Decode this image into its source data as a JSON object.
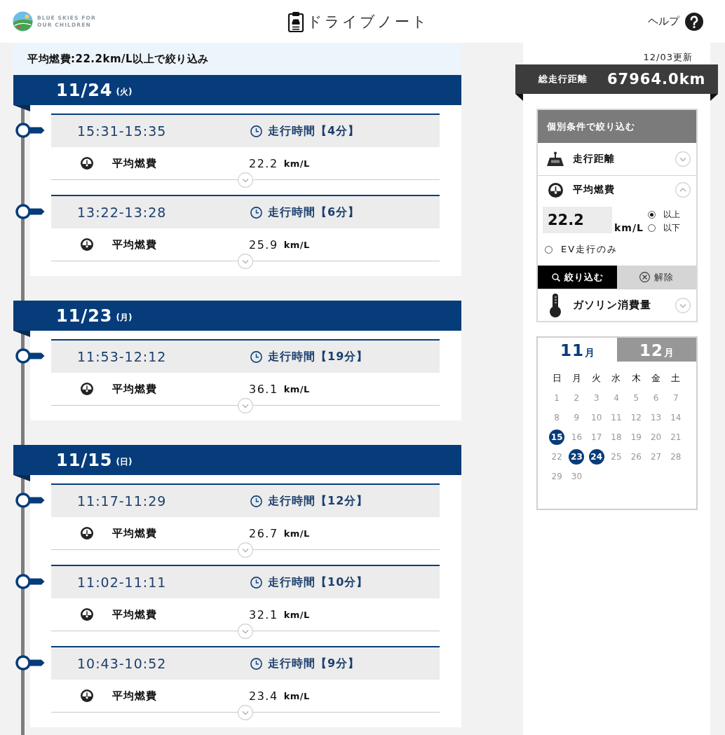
{
  "header": {
    "logo_lines": [
      "BLUE SKIES FOR",
      "OUR CHILDREN"
    ],
    "title": "ドライブノート",
    "help": "ヘルプ"
  },
  "filter_banner": "平均燃費:22.2km/L以上で絞り込み",
  "days": [
    {
      "date": "11/24",
      "weekday": "(火)",
      "trips": [
        {
          "time": "15:31-15:35",
          "duration": "走行時間【4分】",
          "metric_label": "平均燃費",
          "metric_value": "22.2",
          "metric_unit": "km/L",
          "expanded": false
        },
        {
          "time": "13:22-13:28",
          "duration": "走行時間【6分】",
          "metric_label": "平均燃費",
          "metric_value": "25.9",
          "metric_unit": "km/L",
          "expanded": false
        }
      ]
    },
    {
      "date": "11/23",
      "weekday": "(月)",
      "trips": [
        {
          "time": "11:53-12:12",
          "duration": "走行時間【19分】",
          "metric_label": "平均燃費",
          "metric_value": "36.1",
          "metric_unit": "km/L",
          "expanded": false
        }
      ]
    },
    {
      "date": "11/15",
      "weekday": "(日)",
      "trips": [
        {
          "time": "11:17-11:29",
          "duration": "走行時間【12分】",
          "metric_label": "平均燃費",
          "metric_value": "26.7",
          "metric_unit": "km/L",
          "expanded": false
        },
        {
          "time": "11:02-11:11",
          "duration": "走行時間【10分】",
          "metric_label": "平均燃費",
          "metric_value": "32.1",
          "metric_unit": "km/L",
          "expanded": false
        },
        {
          "time": "10:43-10:52",
          "duration": "走行時間【9分】",
          "metric_label": "平均燃費",
          "metric_value": "23.4",
          "metric_unit": "km/L",
          "expanded": false
        }
      ]
    }
  ],
  "sidebar": {
    "updated": "12/03更新",
    "total_distance": {
      "label": "総走行距離",
      "value": "67964.0km"
    },
    "filter": {
      "title": "個別条件で絞り込む",
      "sections": [
        {
          "label": "走行距離",
          "expanded": false
        },
        {
          "label": "平均燃費",
          "expanded": true,
          "value": "22.2",
          "unit": "km/L",
          "options": [
            {
              "label": "以上",
              "selected": true
            },
            {
              "label": "以下",
              "selected": false
            }
          ],
          "ev_only": {
            "label": "EV走行のみ",
            "checked": false
          },
          "buttons": [
            {
              "kind": "apply",
              "label": "絞り込む"
            },
            {
              "kind": "clear",
              "label": "解除"
            }
          ]
        },
        {
          "label": "ガソリン消費量",
          "expanded": false
        }
      ]
    },
    "calendar": {
      "tabs": [
        {
          "month": "11",
          "suffix": "月",
          "selected": true
        },
        {
          "month": "12",
          "suffix": "月",
          "selected": false
        }
      ],
      "weekdays": [
        "日",
        "月",
        "火",
        "水",
        "木",
        "金",
        "土"
      ],
      "dates": [
        {
          "day": "1",
          "highlighted": false
        },
        {
          "day": "2",
          "highlighted": false
        },
        {
          "day": "3",
          "highlighted": false
        },
        {
          "day": "4",
          "highlighted": false
        },
        {
          "day": "5",
          "highlighted": false
        },
        {
          "day": "6",
          "highlighted": false
        },
        {
          "day": "7",
          "highlighted": false
        },
        {
          "day": "8",
          "highlighted": false
        },
        {
          "day": "9",
          "highlighted": false
        },
        {
          "day": "10",
          "highlighted": false
        },
        {
          "day": "11",
          "highlighted": false
        },
        {
          "day": "12",
          "highlighted": false
        },
        {
          "day": "13",
          "highlighted": false
        },
        {
          "day": "14",
          "highlighted": false
        },
        {
          "day": "15",
          "highlighted": true
        },
        {
          "day": "16",
          "highlighted": false
        },
        {
          "day": "17",
          "highlighted": false
        },
        {
          "day": "18",
          "highlighted": false
        },
        {
          "day": "19",
          "highlighted": false
        },
        {
          "day": "20",
          "highlighted": false
        },
        {
          "day": "21",
          "highlighted": false
        },
        {
          "day": "22",
          "highlighted": false
        },
        {
          "day": "23",
          "highlighted": true
        },
        {
          "day": "24",
          "highlighted": true
        },
        {
          "day": "25",
          "highlighted": false
        },
        {
          "day": "26",
          "highlighted": false
        },
        {
          "day": "27",
          "highlighted": false
        },
        {
          "day": "28",
          "highlighted": false
        },
        {
          "day": "29",
          "highlighted": false
        },
        {
          "day": "30",
          "highlighted": false
        }
      ]
    }
  }
}
